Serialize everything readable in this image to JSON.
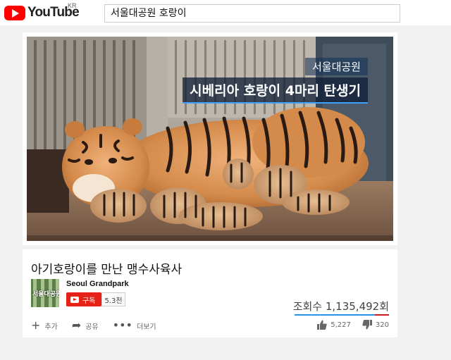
{
  "header": {
    "logo_text": "YouTube",
    "logo_region": "KR",
    "search_value": "서울대공원 호랑이"
  },
  "video": {
    "caption_sub": "서울대공원",
    "caption_main": "시베리아 호랑이 4마리 탄생기"
  },
  "info": {
    "title": "아기호랑이를 만난 맹수사육사",
    "channel_name": "Seoul Grandpark",
    "channel_thumb_text": "서울대공원",
    "subscribe_label": "구독",
    "subscriber_count": "5.3천",
    "views": "조회수 1,135,492회",
    "actions": {
      "add_label": "추가",
      "share_label": "공유",
      "more_label": "더보기"
    },
    "likes": "5,227",
    "dislikes": "320"
  },
  "icons": {
    "logo": "youtube-play-icon",
    "add": "plus-icon",
    "share": "share-arrow-icon",
    "more": "more-dots-icon",
    "like": "thumbs-up-icon",
    "dislike": "thumbs-down-icon",
    "subscribe": "youtube-play-icon"
  },
  "colors": {
    "brand_red": "#ff0000",
    "subscribe_red": "#e62117",
    "views_bar_blue": "#2793e6",
    "caption_accent": "#3ea0ff"
  }
}
